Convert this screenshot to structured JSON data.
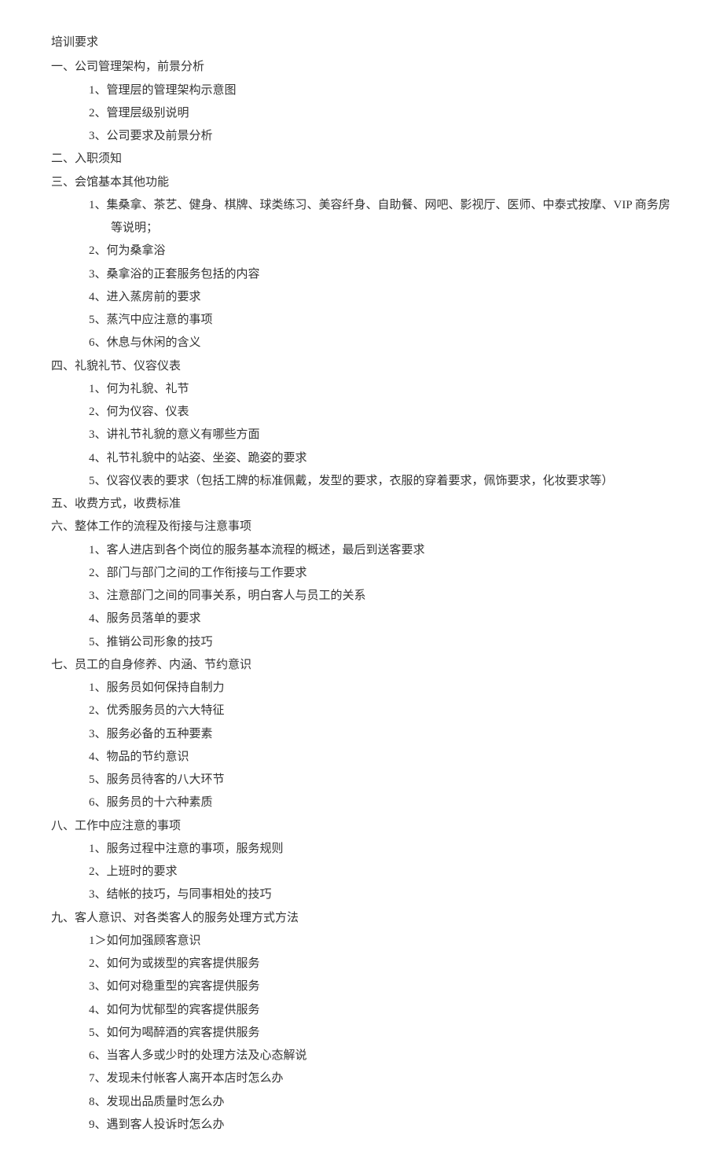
{
  "title": "培训要求",
  "sections": [
    {
      "heading": "一、公司管理架构，前景分析",
      "items": [
        "1、管理层的管理架构示意图",
        "2、管理层级别说明",
        "3、公司要求及前景分析"
      ]
    },
    {
      "heading": "二、入职须知",
      "items": []
    },
    {
      "heading": "三、会馆基本其他功能",
      "items": [
        "1、集桑拿、茶艺、健身、棋牌、球类练习、美容纤身、自助餐、网吧、影视厅、医师、中泰式按摩、VIP 商务房等说明；",
        "2、何为桑拿浴",
        "3、桑拿浴的正套服务包括的内容",
        "4、进入蒸房前的要求",
        "5、蒸汽中应注意的事项",
        "6、休息与休闲的含义"
      ]
    },
    {
      "heading": "四、礼貌礼节、仪容仪表",
      "items": [
        "1、何为礼貌、礼节",
        "2、何为仪容、仪表",
        "3、讲礼节礼貌的意义有哪些方面",
        "4、礼节礼貌中的站姿、坐姿、跪姿的要求",
        "5、仪容仪表的要求（包括工牌的标准佩戴，发型的要求，衣服的穿着要求，佩饰要求，化妆要求等）"
      ]
    },
    {
      "heading": "五、收费方式，收费标准",
      "items": []
    },
    {
      "heading": "六、整体工作的流程及衔接与注意事项",
      "items": [
        "1、客人进店到各个岗位的服务基本流程的概述，最后到送客要求",
        "2、部门与部门之间的工作衔接与工作要求",
        "3、注意部门之间的同事关系，明白客人与员工的关系",
        "4、服务员落单的要求",
        "5、推销公司形象的技巧"
      ]
    },
    {
      "heading": "七、员工的自身修养、内涵、节约意识",
      "items": [
        "1、服务员如何保持自制力",
        "2、优秀服务员的六大特征",
        "3、服务必备的五种要素",
        "4、物品的节约意识",
        "5、服务员待客的八大环节",
        "6、服务员的十六种素质"
      ]
    },
    {
      "heading": "八、工作中应注意的事项",
      "items": [
        "1、服务过程中注意的事项，服务规则",
        "2、上班时的要求",
        "3、结帐的技巧，与同事相处的技巧"
      ]
    },
    {
      "heading": "九、客人意识、对各类客人的服务处理方式方法",
      "items": [
        "1＞如何加强顾客意识",
        "2、如何为或拨型的宾客提供服务",
        "3、如何对稳重型的宾客提供服务",
        "4、如何为忧郁型的宾客提供服务",
        "5、如何为喝醉酒的宾客提供服务",
        "6、当客人多或少时的处理方法及心态解说",
        "7、发现未付帐客人离开本店时怎么办",
        "8、发现出品质量时怎么办",
        "9、遇到客人投诉时怎么办"
      ]
    }
  ]
}
